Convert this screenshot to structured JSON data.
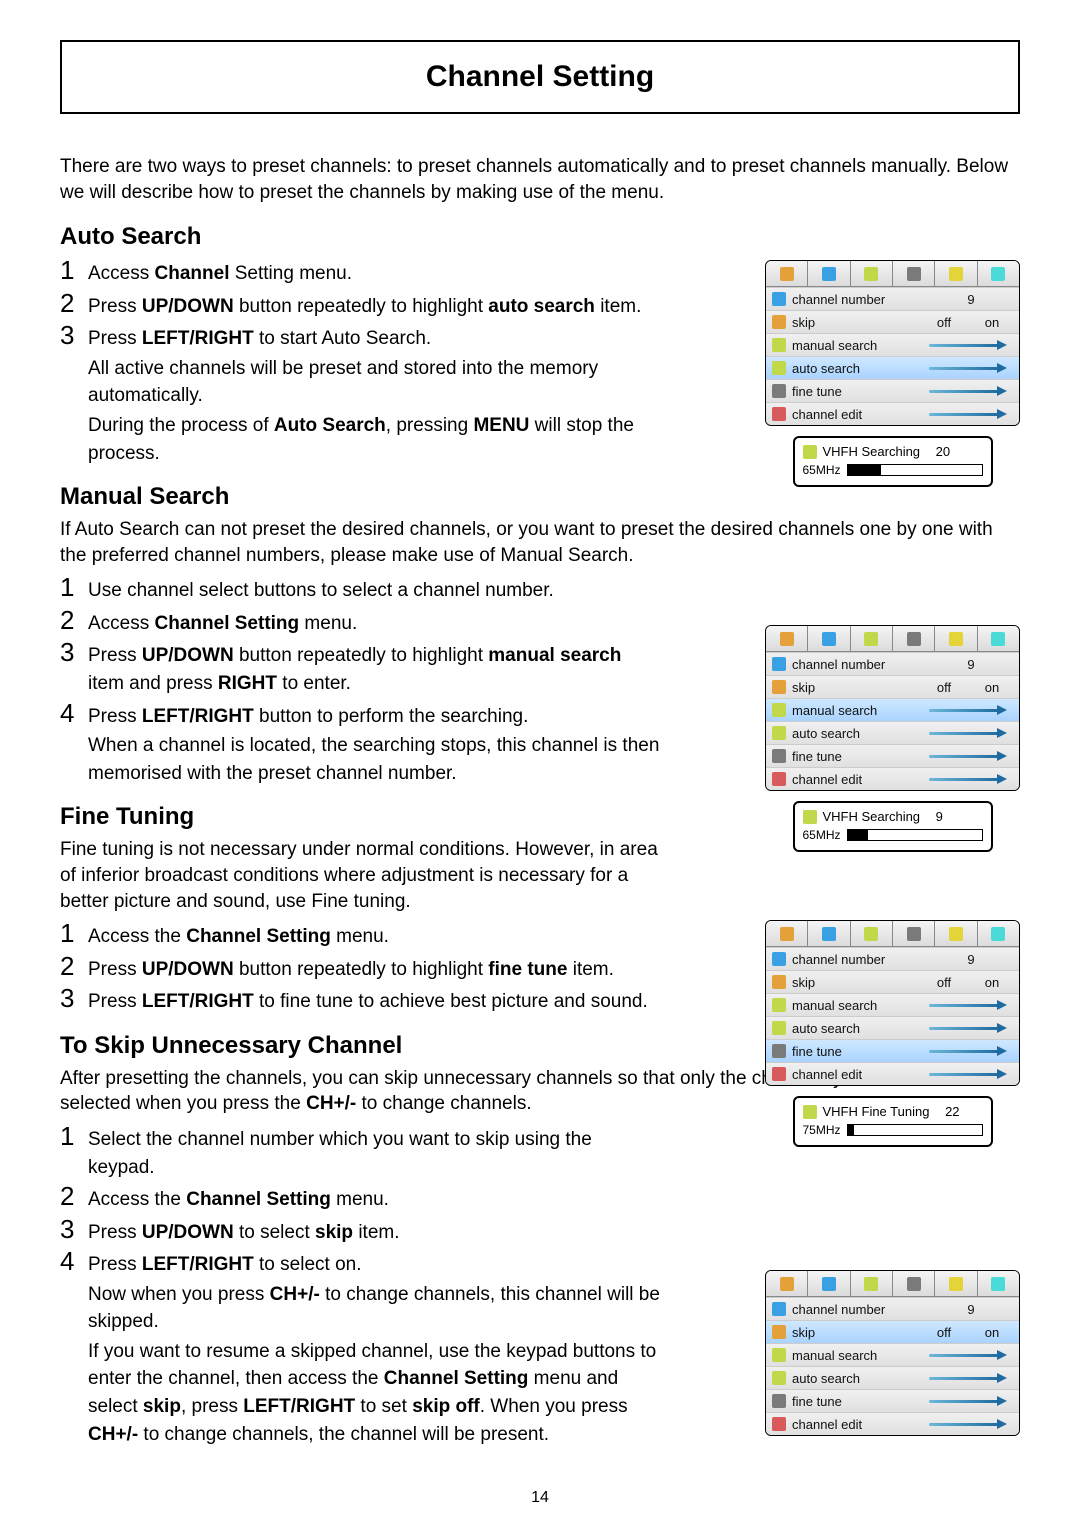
{
  "page_title": "Channel Setting",
  "page_number": "14",
  "intro": "There are two ways to preset channels: to preset channels automatically and to preset channels manually. Below we will describe how to preset the channels by making use of the menu.",
  "auto_search": {
    "heading": "Auto Search",
    "steps": [
      "Access <b>Channel</b> Setting menu.",
      "Press <b>UP/DOWN</b> button repeatedly to highlight <b>auto search</b> item.",
      "Press <b>LEFT/RIGHT</b> to start Auto Search.<span class='indent'>All active channels will be preset and stored into the memory automatically.</span><span class='indent'>During the process of <b>Auto Search</b>, pressing <b>MENU</b> will stop the process.</span>"
    ]
  },
  "manual_search": {
    "heading": "Manual Search",
    "desc": "If Auto Search can not preset the desired channels, or you want to preset the desired channels one by one with the preferred channel numbers, please make use of Manual Search.",
    "steps": [
      "Use channel select buttons to select a channel number.",
      "Access <b>Channel Setting</b> menu.",
      "Press <b>UP/DOWN</b> button repeatedly to highlight <b>manual search</b> item and press <b>RIGHT</b> to enter.",
      "Press <b>LEFT/RIGHT</b> button to perform the searching.<span class='indent'>When a channel is located, the searching stops, this channel is then memorised with the preset channel number.</span>"
    ]
  },
  "fine_tune": {
    "heading": "Fine Tuning",
    "desc": "Fine tuning is not necessary under normal conditions. However, in area of inferior broadcast conditions where adjustment is necessary for a better picture and sound, use Fine tuning.",
    "steps": [
      "Access the <b>Channel Setting</b> menu.",
      "Press <b>UP/DOWN</b> button repeatedly to highlight <b>fine tune</b> item.",
      "Press <b>LEFT/RIGHT</b> to fine tune to achieve best picture and sound."
    ]
  },
  "skip": {
    "heading": "To Skip Unnecessary Channel",
    "desc": "After presetting the channels, you can skip unnecessary channels so that only the channels you want to watch are selected when you press the <b>CH+/-</b> to change channels.",
    "steps": [
      "Select the channel number which you want to skip using the keypad.",
      "Access the <b>Channel Setting</b> menu.",
      "Press <b>UP/DOWN</b> to select <b>skip</b> item.",
      "Press <b>LEFT/RIGHT</b> to select on.<span class='indent'>Now when you press <b>CH+/-</b> to change channels, this channel will be skipped.</span><span class='indent'>If you want to resume a skipped channel, use the keypad buttons to enter the channel, then access the <b>Channel Setting</b> menu and select <b>skip</b>, press <b>LEFT/RIGHT</b> to set <b>skip off</b>. When you press <b>CH+/-</b> to change channels, the channel will be present.</span>"
    ]
  },
  "osd_menu": {
    "rows": {
      "channel_number": "channel number",
      "channel_value": "9",
      "skip": "skip",
      "skip_off": "off",
      "skip_on": "on",
      "manual_search": "manual search",
      "auto_search": "auto search",
      "fine_tune": "fine tune",
      "channel_edit": "channel edit"
    }
  },
  "popups": {
    "auto": {
      "label": "VHFH Searching",
      "value": "20",
      "freq": "65MHz",
      "fill_pct": 25
    },
    "manual": {
      "label": "VHFH Searching",
      "value": "9",
      "freq": "65MHz",
      "fill_pct": 15
    },
    "fine": {
      "label": "VHFH Fine Tuning",
      "value": "22",
      "freq": "75MHz",
      "fill_pct": 5
    }
  }
}
